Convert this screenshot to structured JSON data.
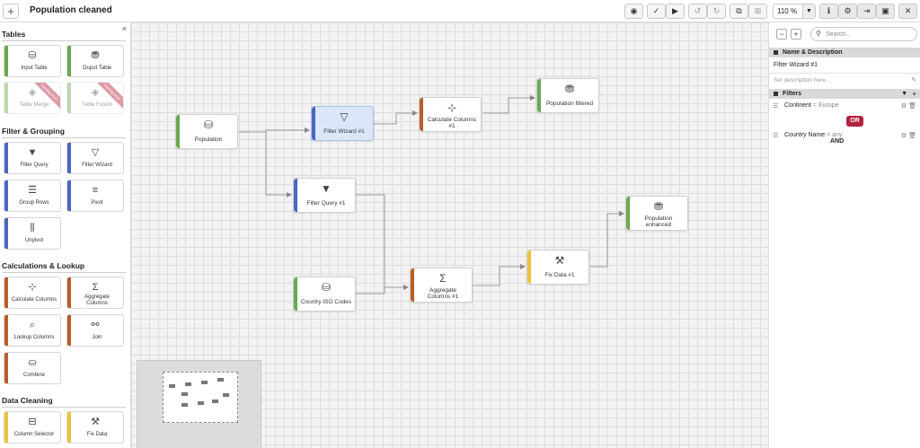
{
  "header": {
    "add_label": "+",
    "title": "Population cleaned",
    "zoom": "110 %"
  },
  "sidebar": {
    "close": "×",
    "sections": {
      "tables": "Tables",
      "filter": "Filter & Grouping",
      "calc": "Calculations & Lookup",
      "cleaning": "Data Cleaning"
    },
    "tiles": {
      "input_table": "Input Table",
      "output_table": "Ouput Table",
      "table_merge": "Table Merge",
      "table_fusion": "Table Fusion",
      "coming_soon": "Coming Soon",
      "filter_query": "Filter Query",
      "filter_wizard": "Filter Wizard",
      "group_rows": "Group Rows",
      "pivot": "Pivot",
      "unpivot": "Unpivot",
      "calculate_columns": "Calculate Columns",
      "aggregate_columns_1": "Aggregate",
      "aggregate_columns_2": "Columns",
      "lookup_columns": "Lookup Columns",
      "join": "Join",
      "combine": "Combine",
      "column_selector": "Column Selector",
      "fix_data": "Fix Data"
    }
  },
  "canvas": {
    "nodes": {
      "population": "Population",
      "filter_wizard": "Filter Wizard #1",
      "calc_cols_1": "Calculate Columns",
      "calc_cols_2": "#1",
      "pop_filtered": "Population filtered",
      "filter_query": "Filter Query #1",
      "country_iso": "Country ISO Codes",
      "aggregate_1": "Aggregate",
      "aggregate_2": "Columns #1",
      "fix_data": "Fix Data #1",
      "pop_enhanced_1": "Population",
      "pop_enhanced_2": "enhanced"
    }
  },
  "right_panel": {
    "minus": "−",
    "plus": "+",
    "search_placeholder": "Search...",
    "name_desc_header": "Name & Description",
    "node_name": "Filter Wizard #1",
    "desc_placeholder": "Set description here...",
    "filters_header": "Filters",
    "filter1_field": "Continent",
    "filter1_op": "=",
    "filter1_value": "Europe",
    "and_label": "AND",
    "or_label": "OR",
    "filter2_field": "Country Name",
    "filter2_op": "=",
    "filter2_value": "any"
  },
  "colors": {
    "table_green": "#6aa84f",
    "filter_blue": "#4a67c2",
    "calc_orange": "#b85e2b",
    "cleaning_yellow": "#f0c23c",
    "or_red": "#b3213d"
  }
}
